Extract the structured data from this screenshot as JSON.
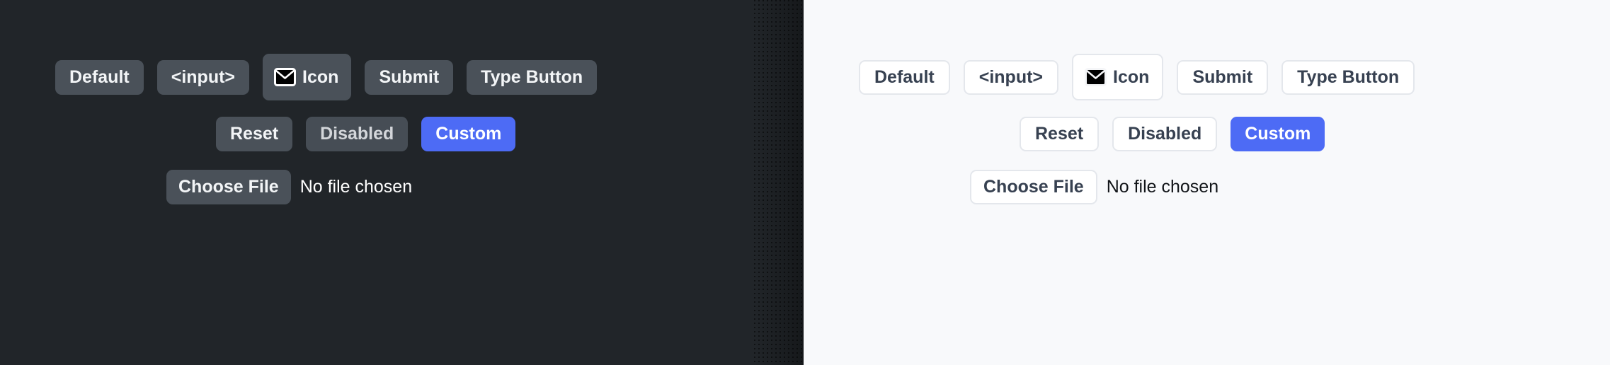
{
  "theme_colors": {
    "dark_background": "#212529",
    "dark_button_background": "#4a5159",
    "dark_button_text": "#f3f5f7",
    "light_background": "#f8f9fb",
    "light_button_background": "#ffffff",
    "light_button_border": "#e4e7ec",
    "light_button_text": "#374151",
    "accent": "#4d6bf5",
    "accent_text": "#ffffff"
  },
  "panels": [
    {
      "theme": "dark",
      "rows": {
        "row1": [
          {
            "label": "Default",
            "variant": "default",
            "icon": null
          },
          {
            "label": "<input>",
            "variant": "default",
            "icon": null
          },
          {
            "label": "Icon",
            "variant": "icon",
            "icon": "envelope-icon"
          },
          {
            "label": "Submit",
            "variant": "default",
            "icon": null
          },
          {
            "label": "Type Button",
            "variant": "default",
            "icon": null
          }
        ],
        "row2": [
          {
            "label": "Reset",
            "variant": "default",
            "icon": null
          },
          {
            "label": "Disabled",
            "variant": "disabled",
            "icon": null
          },
          {
            "label": "Custom",
            "variant": "accent",
            "icon": null
          }
        ],
        "row3": {
          "button_label": "Choose File",
          "status_text": "No file chosen"
        }
      }
    },
    {
      "theme": "light",
      "rows": {
        "row1": [
          {
            "label": "Default",
            "variant": "default",
            "icon": null
          },
          {
            "label": "<input>",
            "variant": "default",
            "icon": null
          },
          {
            "label": "Icon",
            "variant": "icon",
            "icon": "envelope-icon"
          },
          {
            "label": "Submit",
            "variant": "default",
            "icon": null
          },
          {
            "label": "Type Button",
            "variant": "default",
            "icon": null
          }
        ],
        "row2": [
          {
            "label": "Reset",
            "variant": "default",
            "icon": null
          },
          {
            "label": "Disabled",
            "variant": "disabled",
            "icon": null
          },
          {
            "label": "Custom",
            "variant": "accent",
            "icon": null
          }
        ],
        "row3": {
          "button_label": "Choose File",
          "status_text": "No file chosen"
        }
      }
    }
  ]
}
